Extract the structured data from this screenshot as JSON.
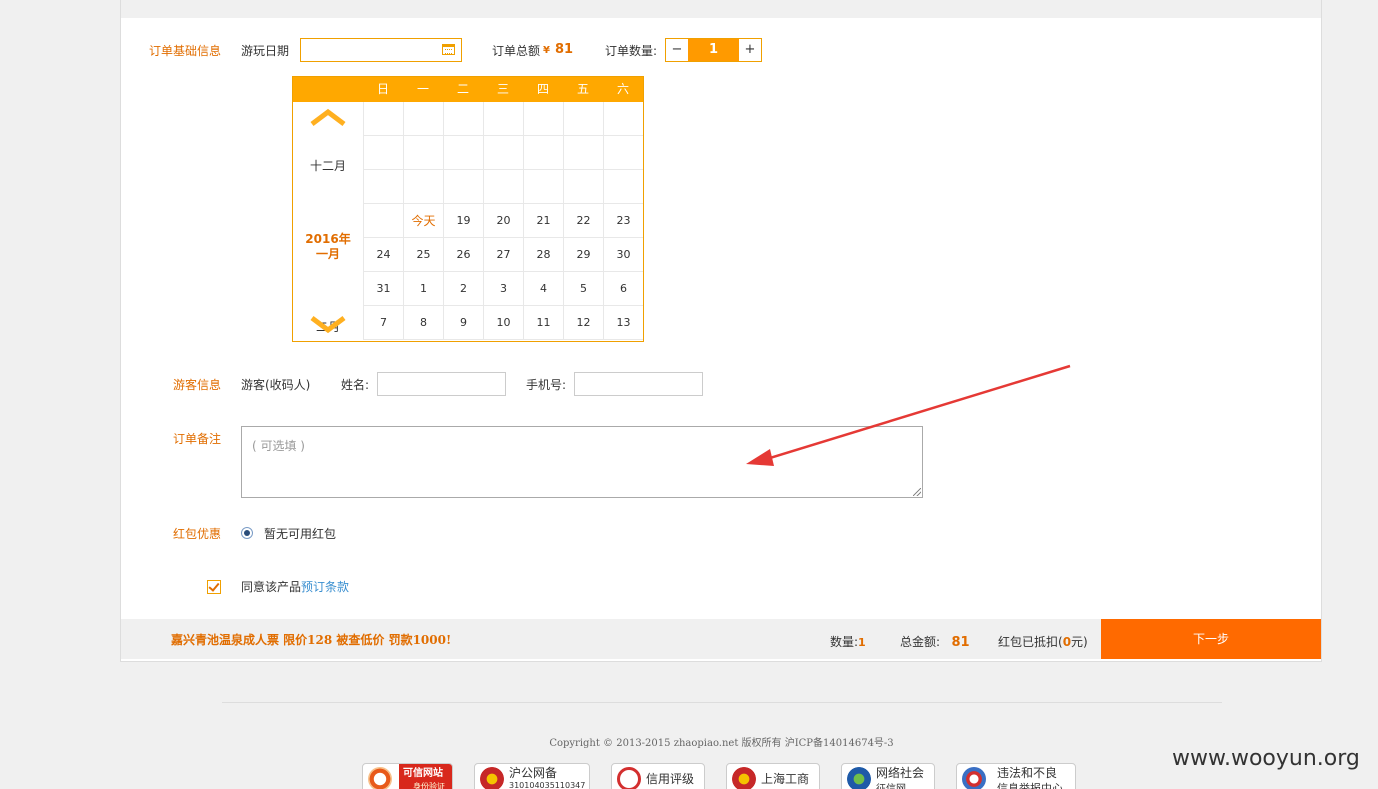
{
  "order_basic": {
    "section_label": "订单基础信息",
    "date_label": "游玩日期",
    "date_value": "",
    "total_label": "订单总额",
    "currency_symbol": "¥",
    "total_value": "81",
    "qty_label": "订单数量:",
    "qty_minus": "−",
    "qty_value": "1",
    "qty_plus": "+"
  },
  "calendar": {
    "weekdays": [
      "日",
      "一",
      "二",
      "三",
      "四",
      "五",
      "六"
    ],
    "prev_month": "十二月",
    "current_year": "2016年",
    "current_month": "一月",
    "next_month": "二月",
    "rows": [
      [
        "",
        "",
        "",
        "",
        "",
        "",
        ""
      ],
      [
        "",
        "",
        "",
        "",
        "",
        "",
        ""
      ],
      [
        "",
        "",
        "",
        "",
        "",
        "",
        ""
      ],
      [
        "",
        "今天",
        "19",
        "20",
        "21",
        "22",
        "23"
      ],
      [
        "24",
        "25",
        "26",
        "27",
        "28",
        "29",
        "30"
      ],
      [
        "31",
        "1",
        "2",
        "3",
        "4",
        "5",
        "6"
      ],
      [
        "7",
        "8",
        "9",
        "10",
        "11",
        "12",
        "13"
      ]
    ]
  },
  "visitor": {
    "section_label": "游客信息",
    "visitor_type": "游客(收码人)",
    "name_label": "姓名:",
    "name_value": "",
    "phone_label": "手机号:",
    "phone_value": ""
  },
  "remark": {
    "section_label": "订单备注",
    "placeholder": "( 可选填 )"
  },
  "redpacket": {
    "section_label": "红包优惠",
    "option": "暂无可用红包"
  },
  "agreement": {
    "text": "同意该产品",
    "link": "预订条款"
  },
  "bottom": {
    "title": "嘉兴青池温泉成人票 限价128 被查低价 罚款1000!",
    "qty_label": "数量:",
    "qty_value": "1",
    "amount_label": "总金额:",
    "amount_value": "81",
    "discount_label": "红包已抵扣(",
    "discount_value": "0",
    "discount_unit": "元)",
    "next_button": "下一步"
  },
  "footer": {
    "copyright": "Copyright © 2013-2015 zhaopiao.net 版权所有 沪ICP备14014674号-3",
    "badges": [
      {
        "title": "可信网站",
        "sub": "身份验证",
        "icon": "trusted-site-icon"
      },
      {
        "title": "沪公网备",
        "sub": "31010403511034​7",
        "icon": "police-emblem-icon"
      },
      {
        "title": "信用评级",
        "sub": "",
        "icon": "credit-rating-icon"
      },
      {
        "title": "上海工商",
        "sub": "",
        "icon": "commerce-emblem-icon"
      },
      {
        "title": "网络社会",
        "sub": "征信网",
        "icon": "network-credit-icon"
      },
      {
        "title": "违法和不良",
        "sub": "信息举报中心",
        "icon": "report-center-icon"
      }
    ]
  },
  "watermark": "www.wooyun.org",
  "colors": {
    "accent": "#e16d00",
    "calendar_header": "#ffa800",
    "next_button": "#ff6a00",
    "annotation_arrow": "#e53935"
  }
}
